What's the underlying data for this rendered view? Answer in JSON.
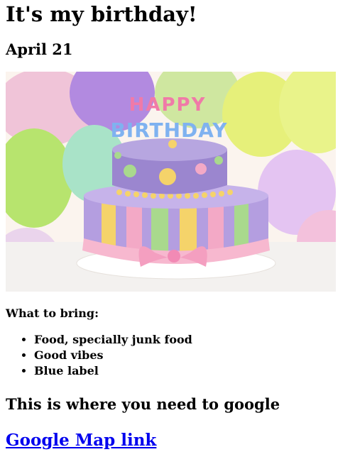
{
  "page": {
    "title": "It's my birthday!",
    "date": "April 21"
  },
  "hero_image": {
    "alt": "cake",
    "candle_text_top": "HAPPY",
    "candle_text_bottom": "BIRTHDAY",
    "balloon_colors": [
      "#b28ae0",
      "#e6f07a",
      "#f0c4d8",
      "#a9e3c8",
      "#cfe7a0"
    ],
    "cake_colors": {
      "top_tier": "#9b86cf",
      "bottom_tier": "#b49ee0",
      "stripes": [
        "#f5d36a",
        "#a9d98d",
        "#f3a9c6"
      ],
      "ribbon": "#f7b8cf"
    }
  },
  "bring": {
    "title": "What to bring:",
    "items": [
      "Food, specially junk food",
      "Good vibes",
      "Blue label"
    ]
  },
  "location": {
    "heading": "This is where you need to google",
    "link_text": "Google Map link"
  }
}
